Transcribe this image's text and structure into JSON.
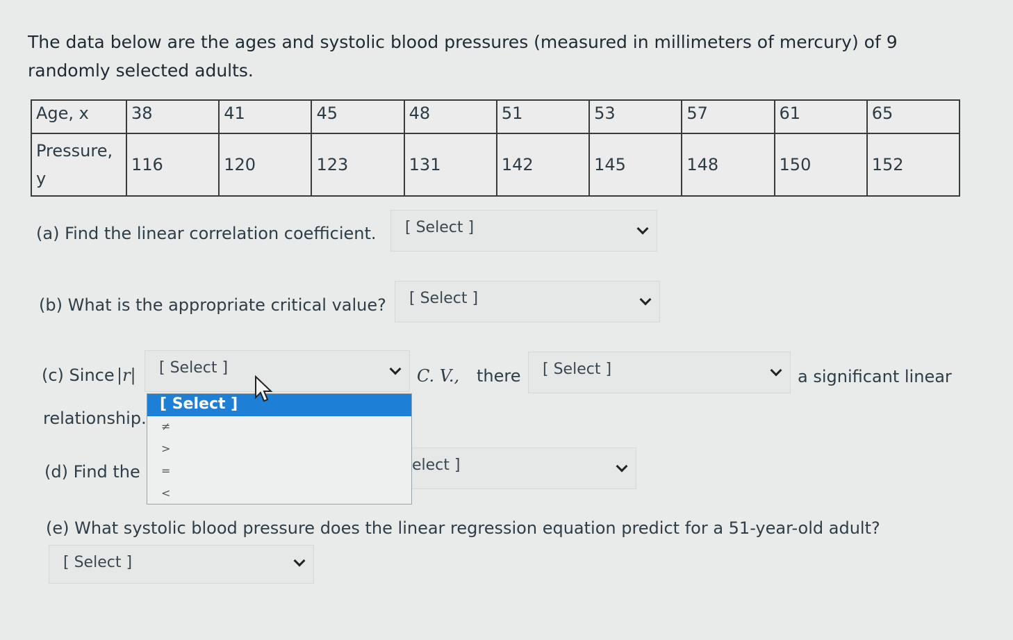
{
  "intro_text": "The data below are the ages and systolic blood pressures (measured in millimeters of mercury) of 9 randomly selected adults.",
  "table": {
    "age_header": "Age, x",
    "pressure_header_1": "Pressure,",
    "pressure_header_2": "y",
    "ages": [
      "38",
      "41",
      "45",
      "48",
      "51",
      "53",
      "57",
      "61",
      "65"
    ],
    "pressures": [
      "116",
      "120",
      "123",
      "131",
      "142",
      "145",
      "148",
      "150",
      "152"
    ]
  },
  "questions": {
    "a": "(a) Find the linear correlation coefficient.",
    "b": "(b) What is the appropriate critical value?",
    "c_prefix": "(c) Since",
    "c_r": "|r|",
    "c_cv": "C. V.,",
    "c_there": "there",
    "c_suffix": "a significant linear",
    "c_line2": "relationship.",
    "d_prefix": "(d) Find the",
    "e": "(e) What systolic blood pressure does the linear regression equation predict for a 51-year-old adult?"
  },
  "selects": {
    "a": "[ Select ]",
    "b": "[ Select ]",
    "c1": "[ Select ]",
    "c2": "[ Select ]",
    "d_partial": "elect ]",
    "e": "[ Select ]"
  },
  "dropdown_options": [
    "[ Select ]",
    "≠",
    ">",
    "=",
    "<"
  ]
}
